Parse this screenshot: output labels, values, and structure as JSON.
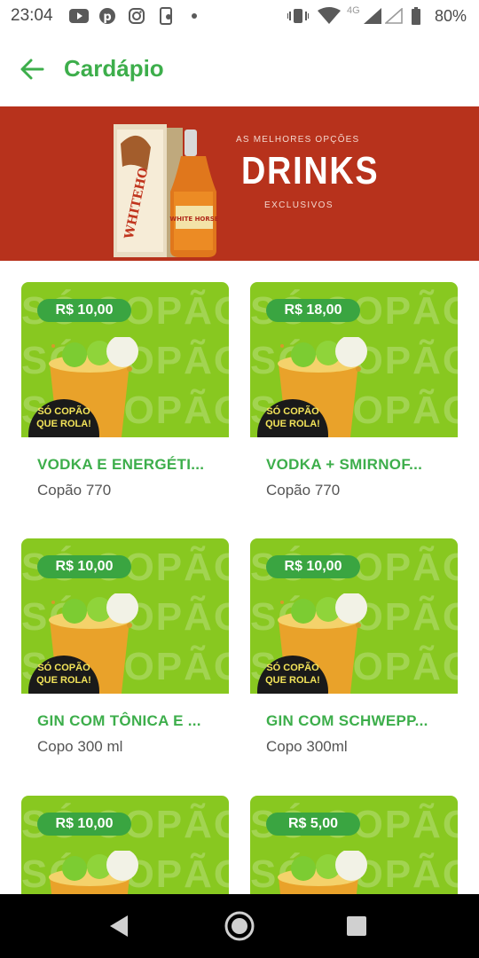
{
  "status_bar": {
    "time": "23:04",
    "network": "4G",
    "battery": "80%",
    "left_icons": [
      "youtube-icon",
      "pinterest-icon",
      "instagram-icon",
      "phone-app-icon",
      "dot-icon"
    ],
    "right_icons": [
      "vibrate-icon",
      "wifi-icon",
      "signal-icon",
      "signal-empty-icon",
      "battery-icon"
    ]
  },
  "app_bar": {
    "title": "Cardápio",
    "back_icon": "arrow-left-icon"
  },
  "banner": {
    "kicker": "AS MELHORES OPÇÕES",
    "title": "DRINKS",
    "subtitle": "EXCLUSIVOS",
    "product_box_text": "WHITEHO",
    "bottle_label": "WHITE HORSE"
  },
  "image_watermark": "SÓ COPÃO",
  "logo_text": {
    "line1": "SÓ COPÃO",
    "line2": "QUE ROLA!"
  },
  "products": [
    {
      "name": "VODKA E ENERGÉTI...",
      "description": "Copão 770",
      "price": "R$ 10,00"
    },
    {
      "name": "VODKA + SMIRNOF...",
      "description": "Copão 770",
      "price": "R$ 18,00"
    },
    {
      "name": "GIN COM TÔNICA E ...",
      "description": "Copo 300 ml",
      "price": "R$ 10,00"
    },
    {
      "name": "GIN COM SCHWEPP...",
      "description": "Copo 300ml",
      "price": "R$ 10,00"
    },
    {
      "name": "",
      "description": "",
      "price": "R$ 10,00"
    },
    {
      "name": "",
      "description": "",
      "price": "R$ 5,00"
    }
  ],
  "nav_bar": {
    "buttons": [
      "back-triangle-icon",
      "home-circle-icon",
      "recents-square-icon"
    ]
  },
  "colors": {
    "accent_green": "#3dae4b",
    "banner_red": "#b7321c",
    "card_lime": "#88c820",
    "price_green": "#3aa541"
  }
}
